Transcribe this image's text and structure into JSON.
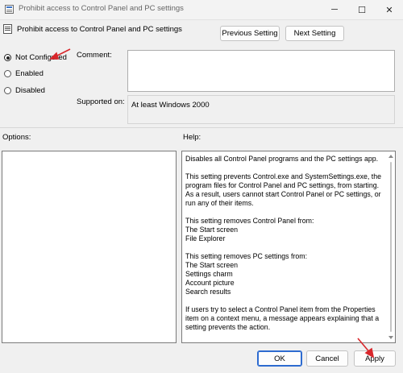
{
  "window": {
    "title": "Prohibit access to Control Panel and PC settings",
    "minimize_glyph": "─",
    "maximize_glyph": "☐",
    "close_glyph": "✕"
  },
  "header": {
    "policy_title": "Prohibit access to Control Panel and PC settings",
    "previous_button": "Previous Setting",
    "next_button": "Next Setting"
  },
  "state": {
    "options": [
      {
        "label": "Not Configured",
        "checked": true
      },
      {
        "label": "Enabled",
        "checked": false
      },
      {
        "label": "Disabled",
        "checked": false
      }
    ]
  },
  "fields": {
    "comment_label": "Comment:",
    "comment_value": "",
    "supported_label": "Supported on:",
    "supported_value": "At least Windows 2000"
  },
  "sections": {
    "options_label": "Options:",
    "help_label": "Help:"
  },
  "help": {
    "paragraphs": [
      [
        "Disables all Control Panel programs and the PC settings app."
      ],
      [
        "This setting prevents Control.exe and SystemSettings.exe, the program files for Control Panel and PC settings, from starting. As a result, users cannot start Control Panel or PC settings, or run any of their items."
      ],
      [
        "This setting removes Control Panel from:",
        "The Start screen",
        "File Explorer"
      ],
      [
        "This setting removes PC settings from:",
        "The Start screen",
        "Settings charm",
        "Account picture",
        "Search results"
      ],
      [
        "If users try to select a Control Panel item from the Properties item on a context menu, a message appears explaining that a setting prevents the action."
      ]
    ]
  },
  "footer": {
    "ok": "OK",
    "cancel": "Cancel",
    "apply": "Apply"
  },
  "colors": {
    "annotation_arrow": "#d8262b",
    "primary_border": "#2d6bd0"
  }
}
